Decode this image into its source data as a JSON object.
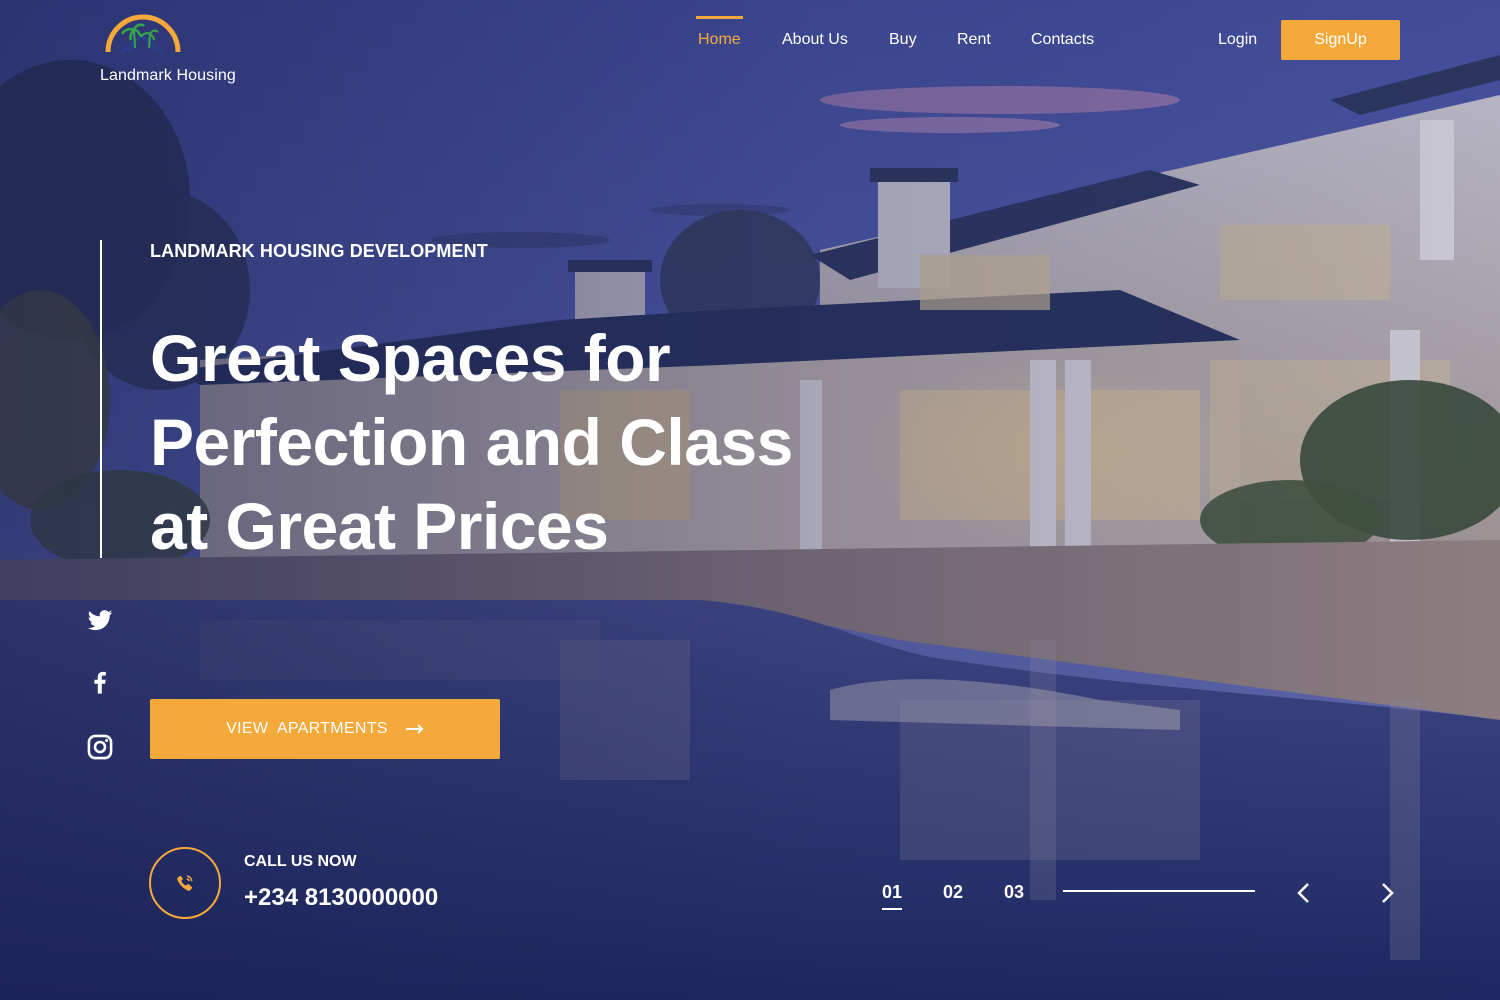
{
  "brand": {
    "name": "Landmark Housing",
    "accent_color": "#f6a93b",
    "logo_icon": "house-palm-sun-logo"
  },
  "nav": {
    "items": [
      {
        "label": "Home",
        "active": true
      },
      {
        "label": "About Us",
        "active": false
      },
      {
        "label": "Buy",
        "active": false
      },
      {
        "label": "Rent",
        "active": false
      },
      {
        "label": "Contacts",
        "active": false
      }
    ],
    "login_label": "Login",
    "signup_label": "SignUp"
  },
  "hero": {
    "eyebrow": "LANDMARK HOUSING DEVELOPMENT",
    "headline_lines": [
      "Great Spaces for",
      "Perfection and Class",
      "at Great Prices"
    ],
    "cta_label": "VIEW  APARTMENTS",
    "cta_icon": "arrow-right-icon",
    "background_scene": "modern villa with pool at dusk"
  },
  "social": [
    {
      "name": "twitter",
      "icon": "twitter-icon"
    },
    {
      "name": "facebook",
      "icon": "facebook-icon"
    },
    {
      "name": "instagram",
      "icon": "instagram-icon"
    }
  ],
  "call": {
    "label": "CALL US NOW",
    "number": "+234 8130000000",
    "icon": "phone-icon"
  },
  "slider": {
    "slides": [
      "01",
      "02",
      "03"
    ],
    "active_index": 0,
    "prev_icon": "chevron-left-icon",
    "next_icon": "chevron-right-icon"
  }
}
